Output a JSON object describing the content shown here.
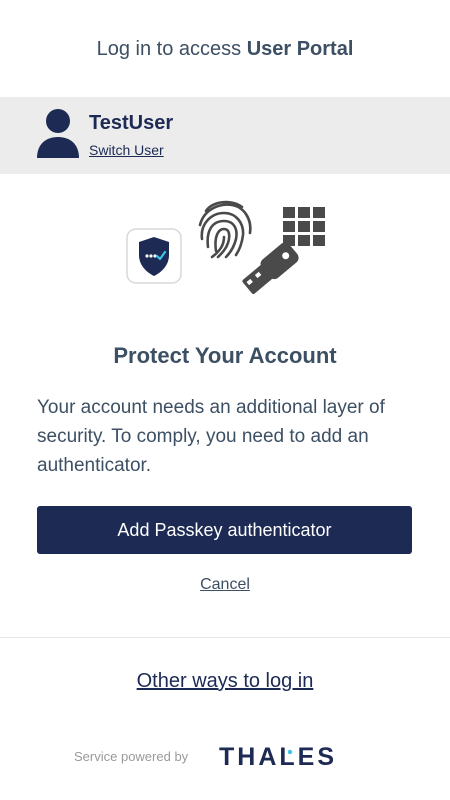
{
  "header": {
    "prefix": "Log in to access ",
    "portal_name": "User Portal"
  },
  "user": {
    "name": "TestUser",
    "switch_label": "Switch User"
  },
  "illustration": {
    "icons": [
      "shield-app-icon",
      "fingerprint-icon",
      "keypad-icon",
      "usb-key-icon"
    ]
  },
  "main": {
    "title": "Protect Your Account",
    "description": "Your account needs an additional layer of security. To comply, you need to add an authenticator.",
    "primary_button": "Add Passkey authenticator",
    "cancel_label": "Cancel"
  },
  "other_ways_label": "Other ways to log in",
  "footer": {
    "powered_by": "Service powered by",
    "brand": "THALES"
  },
  "colors": {
    "brand_navy": "#1c2a54",
    "text_slate": "#3d4f63",
    "user_bar_bg": "#ececec",
    "icon_gray": "#4a4a4a",
    "accent_cyan": "#3cc3e6"
  }
}
